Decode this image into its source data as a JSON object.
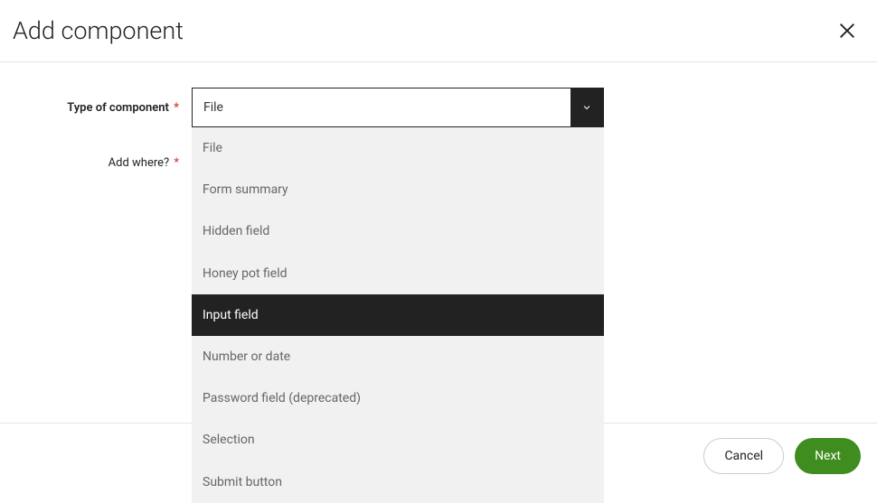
{
  "modal": {
    "title": "Add component"
  },
  "form": {
    "type_label": "Type of component",
    "where_label": "Add where?",
    "required_mark": "*",
    "selected_type": "File"
  },
  "dropdown": {
    "items": [
      {
        "label": "File",
        "highlighted": false
      },
      {
        "label": "Form summary",
        "highlighted": false
      },
      {
        "label": "Hidden field",
        "highlighted": false
      },
      {
        "label": "Honey pot field",
        "highlighted": false
      },
      {
        "label": "Input field",
        "highlighted": true
      },
      {
        "label": "Number or date",
        "highlighted": false
      },
      {
        "label": "Password field (deprecated)",
        "highlighted": false
      },
      {
        "label": "Selection",
        "highlighted": false
      },
      {
        "label": "Submit button",
        "highlighted": false
      }
    ]
  },
  "footer": {
    "cancel": "Cancel",
    "next": "Next"
  }
}
